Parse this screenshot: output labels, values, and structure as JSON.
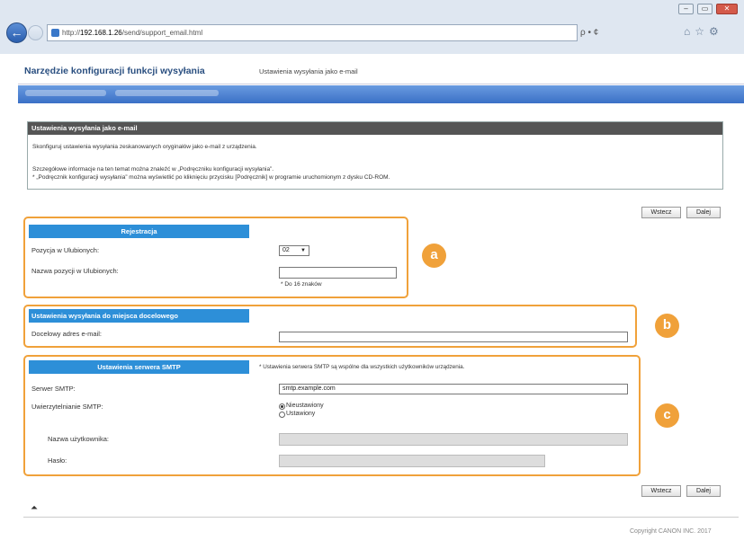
{
  "browser": {
    "url_prefix": "http://",
    "url_host": "192.168.1.26",
    "url_path": "/send/support_email.html",
    "search_glyph": "ρ • ¢",
    "window_controls": [
      "–",
      "▭",
      "✕"
    ],
    "toolbar_glyphs": "⌂☆⚙"
  },
  "app": {
    "title": "Narzędzie konfiguracji funkcji wysyłania",
    "subtitle": "Ustawienia wysyłania jako e-mail"
  },
  "info": {
    "title": "Ustawienia wysyłania jako e-mail",
    "line1": "Skonfiguruj ustawienia wysyłania zeskanowanych oryginałów jako e-mail z urządzenia.",
    "line2": "Szczegółowe informacje na ten temat można znaleźć w „Podręczniku konfiguracji wysyłania”.",
    "line3": "* „Podręcznik konfiguracji wysyłania” można wyświetlić po kliknięciu przycisku [Podręcznik] w programie uruchomionym z dysku CD-ROM."
  },
  "nav_buttons": {
    "back": "Wstecz",
    "next": "Dalej"
  },
  "registration": {
    "header": "Rejestracja",
    "position_label": "Pozycja w Ulubionych:",
    "position_value": "02",
    "name_label": "Nazwa pozycji w Ulubionych:",
    "name_value": "",
    "name_note": "* Do 16 znaków",
    "badge": "a"
  },
  "destination": {
    "header": "Ustawienia wysyłania do miejsca docelowego",
    "email_label": "Docelowy adres e-mail:",
    "email_value": "",
    "badge": "b"
  },
  "smtp": {
    "header": "Ustawienia serwera SMTP",
    "note": "* Ustawienia serwera SMTP są wspólne dla wszystkich użytkowników urządzenia.",
    "server_label": "Serwer SMTP:",
    "server_value": "smtp.example.com",
    "auth_label": "Uwierzytelnianie SMTP:",
    "auth_option_off": "Nieustawiony",
    "auth_option_on": "Ustawiony",
    "user_label": "Nazwa użytkownika:",
    "password_label": "Hasło:",
    "badge": "c"
  },
  "footer": {
    "top_glyph": "⏶",
    "copyright": "Copyright CANON INC. 2017"
  }
}
